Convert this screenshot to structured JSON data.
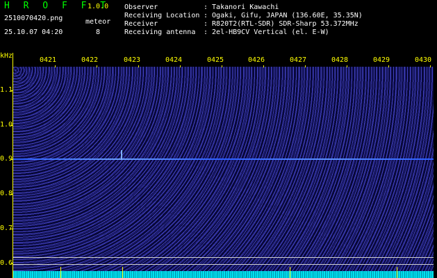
{
  "header": {
    "app_name": "H R O F F T",
    "version": "1.0.0",
    "file_name": "2510070420.png",
    "datetime": "25.10.07 04:20",
    "meteor_label": "meteor",
    "meteor_count": "8",
    "fields": [
      {
        "label": "Observer",
        "value": ": Takanori Kawachi"
      },
      {
        "label": "Receiving Location",
        "value": ": Ogaki, Gifu, JAPAN (136.60E, 35.35N)"
      },
      {
        "label": "Receiver",
        "value": ": R820T2(RTL-SDR) SDR-Sharp 53.372MHz"
      },
      {
        "label": "Receiving antenna",
        "value": ": 2el-HB9CV Vertical (el. E-W)"
      }
    ]
  },
  "spectrogram": {
    "y_unit": "kHz",
    "time_labels": [
      "0421",
      "0422",
      "0423",
      "0424",
      "0425",
      "0426",
      "0427",
      "0428",
      "0429",
      "0430"
    ],
    "freq_labels": [
      "1.1",
      "1.0",
      "0.9",
      "0.8",
      "0.7",
      "0.6"
    ],
    "colors": {
      "background": "#08083a",
      "signal": "#4a7fff",
      "axis": "#ffff00",
      "band": "#00d8e8"
    }
  }
}
